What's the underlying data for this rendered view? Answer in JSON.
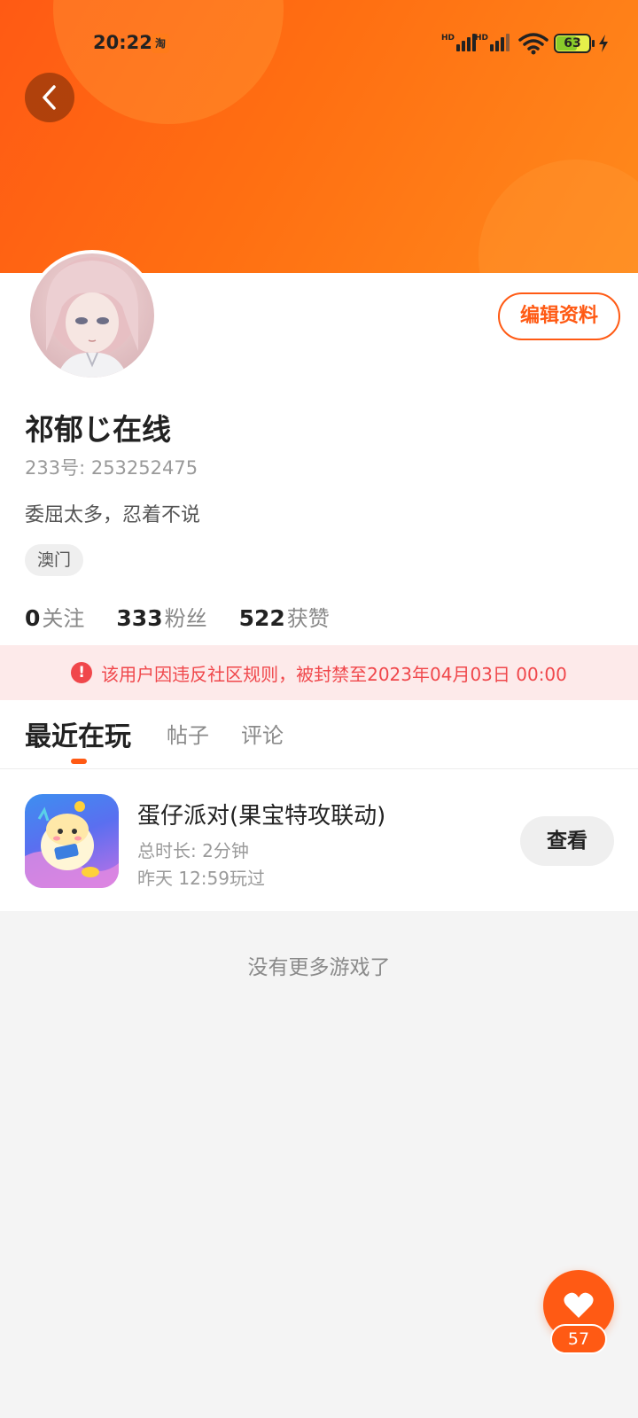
{
  "status_bar": {
    "time": "20:22",
    "app_notification": "淘",
    "signal_hd_1": "HD",
    "signal_hd_2": "HD",
    "battery_level": "63",
    "battery_fraction": 0.63
  },
  "header": {
    "back_icon": "chevron-left-icon"
  },
  "profile": {
    "edit_label": "编辑资料",
    "username": "祁郁じ在线",
    "user_id": "233号: 253252475",
    "bio": "委屈太多，忍着不说",
    "location": "澳门",
    "stats": [
      {
        "num": "0",
        "label": "关注"
      },
      {
        "num": "333",
        "label": "粉丝"
      },
      {
        "num": "522",
        "label": "获赞"
      }
    ]
  },
  "ban_notice": {
    "icon": "warning-icon",
    "text": "该用户因违反社区规则，被封禁至2023年04月03日 00:00"
  },
  "tabs": [
    {
      "label": "最近在玩",
      "active": true
    },
    {
      "label": "帖子",
      "active": false
    },
    {
      "label": "评论",
      "active": false
    }
  ],
  "games": [
    {
      "title": "蛋仔派对(果宝特攻联动)",
      "duration": "总时长: 2分钟",
      "last_played": "昨天 12:59玩过",
      "action": "查看"
    }
  ],
  "empty_text": "没有更多游戏了",
  "like": {
    "icon": "heart-icon",
    "count": "57"
  },
  "colors": {
    "accent": "#ff5a14",
    "warning": "#f0474b"
  }
}
